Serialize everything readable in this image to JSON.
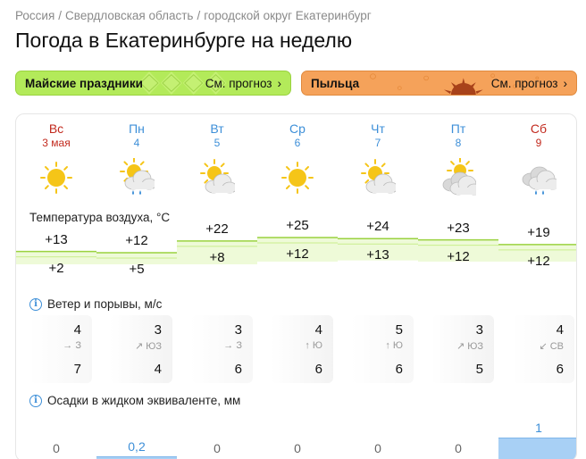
{
  "breadcrumb": [
    "Россия",
    "Свердловская область",
    "городской округ Екатеринбург"
  ],
  "page_title": "Погода в Екатеринбурге на неделю",
  "promos": [
    {
      "title": "Майские праздники",
      "link": "См. прогноз",
      "color": "#b3ea5a"
    },
    {
      "title": "Пыльца",
      "link": "См. прогноз",
      "color": "#f5a25a"
    }
  ],
  "days": [
    {
      "name": "Вс",
      "date": "3 мая",
      "weekend": true,
      "icon": "sun-icon",
      "t_max": "+13",
      "t_min": "+2",
      "wind_speed": "4",
      "wind_dir": "→ З",
      "gust": "7",
      "precip": "0",
      "precip_amount": 0
    },
    {
      "name": "Пн",
      "date": "4",
      "weekend": false,
      "icon": "partly-cloudy-rain-icon",
      "t_max": "+12",
      "t_min": "+5",
      "wind_speed": "3",
      "wind_dir": "↗ ЮЗ",
      "gust": "4",
      "precip": "0,2",
      "precip_amount": 0.2
    },
    {
      "name": "Вт",
      "date": "5",
      "weekend": false,
      "icon": "partly-cloudy-icon",
      "t_max": "+22",
      "t_min": "+8",
      "wind_speed": "3",
      "wind_dir": "→ З",
      "gust": "6",
      "precip": "0",
      "precip_amount": 0
    },
    {
      "name": "Ср",
      "date": "6",
      "weekend": false,
      "icon": "sun-icon",
      "t_max": "+25",
      "t_min": "+12",
      "wind_speed": "4",
      "wind_dir": "↑ Ю",
      "gust": "6",
      "precip": "0",
      "precip_amount": 0
    },
    {
      "name": "Чт",
      "date": "7",
      "weekend": false,
      "icon": "partly-cloudy-icon",
      "t_max": "+24",
      "t_min": "+13",
      "wind_speed": "5",
      "wind_dir": "↑ Ю",
      "gust": "6",
      "precip": "0",
      "precip_amount": 0
    },
    {
      "name": "Пт",
      "date": "8",
      "weekend": false,
      "icon": "cloudy-icon",
      "t_max": "+23",
      "t_min": "+12",
      "wind_speed": "3",
      "wind_dir": "↗ ЮЗ",
      "gust": "5",
      "precip": "0",
      "precip_amount": 0
    },
    {
      "name": "Сб",
      "date": "9",
      "weekend": true,
      "icon": "cloud-rain-icon",
      "t_max": "+19",
      "t_min": "+12",
      "wind_speed": "4",
      "wind_dir": "↙ СВ",
      "gust": "6",
      "precip": "1",
      "precip_amount": 1
    }
  ],
  "sections": {
    "temperature": "Температура воздуха, °C",
    "wind": "Ветер и порывы, м/с",
    "precip": "Осадки в жидком эквиваленте, мм"
  },
  "colors": {
    "weekend": "#c22a1e",
    "weekday": "#3d8fd8",
    "temp_fill": "#eefad8",
    "temp_line": "#9ad23f",
    "precip": "#a8d0f5",
    "sun": "#f5c518"
  }
}
